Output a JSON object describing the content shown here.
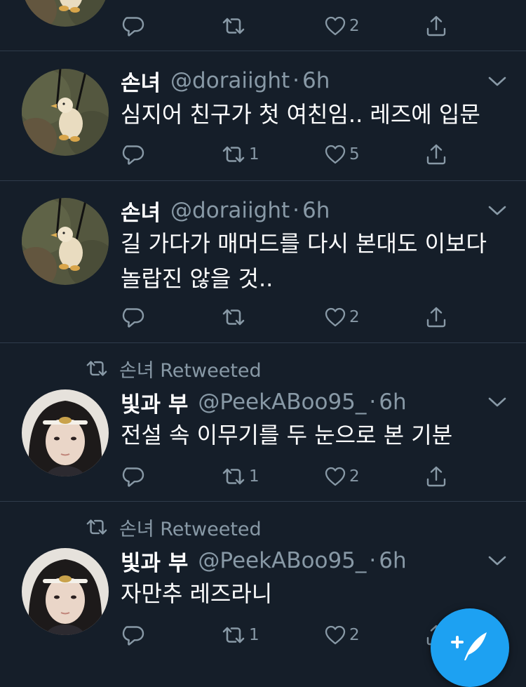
{
  "colors": {
    "background": "#151e29",
    "divider": "#2f3c4b",
    "muted": "#8899a6",
    "accent": "#1da1f2"
  },
  "top_partial": {
    "actions": {
      "reply": "",
      "retweet": "",
      "like": "2",
      "share": ""
    }
  },
  "tweets": [
    {
      "retweeted_by": "",
      "name": "손녀",
      "handle": "@doraiight",
      "dot": "·",
      "time": "6h",
      "text_lines": [
        "심지어 친구가 첫 여친임.. 레즈에 입문"
      ],
      "actions": {
        "reply": "",
        "retweet": "1",
        "like": "5",
        "share": ""
      },
      "avatar": "duck-avatar"
    },
    {
      "retweeted_by": "",
      "name": "손녀",
      "handle": "@doraiight",
      "dot": "·",
      "time": "6h",
      "text_lines": [
        "길 가다가 매머드를 다시 본대도 이보다",
        "놀랍진 않을 것.."
      ],
      "actions": {
        "reply": "",
        "retweet": "",
        "like": "2",
        "share": ""
      },
      "avatar": "duck-avatar"
    },
    {
      "retweeted_by": "손녀 Retweeted",
      "name": "빛과 부",
      "handle": "@PeekABoo95_",
      "dot": "·",
      "time": "6h",
      "text_lines": [
        "전설 속 이무기를 두 눈으로 본 기분"
      ],
      "actions": {
        "reply": "",
        "retweet": "1",
        "like": "2",
        "share": ""
      },
      "avatar": "girl-avatar"
    },
    {
      "retweeted_by": "손녀 Retweeted",
      "name": "빛과 부",
      "handle": "@PeekABoo95_",
      "dot": "·",
      "time": "6h",
      "text_lines": [
        "자만추 레즈라니"
      ],
      "actions": {
        "reply": "",
        "retweet": "1",
        "like": "2",
        "share": ""
      },
      "avatar": "girl-avatar"
    }
  ],
  "fab": {
    "icon": "compose-feather-icon"
  }
}
